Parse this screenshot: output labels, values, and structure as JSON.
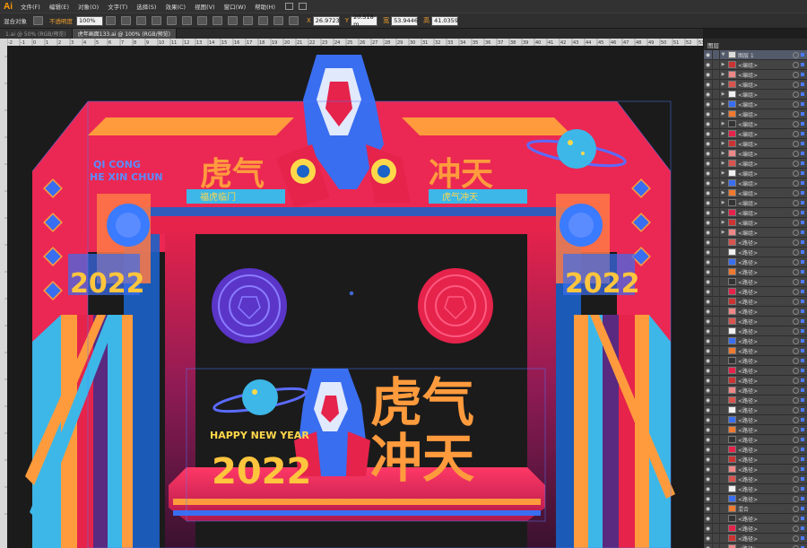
{
  "app": {
    "logo": "Ai"
  },
  "menu": [
    "文件(F)",
    "编辑(E)",
    "对象(O)",
    "文字(T)",
    "选择(S)",
    "效果(C)",
    "视图(V)",
    "窗口(W)",
    "帮助(H)"
  ],
  "control": {
    "selection": "混合对象",
    "opacity_link": "不透明度",
    "opacity_value": "100%",
    "x": "26.9723",
    "y": "20.518 m",
    "w": "53.9446",
    "h": "41.0359",
    "x_key": "X",
    "y_key": "Y",
    "w_key": "宽",
    "h_key": "高"
  },
  "tabs": [
    {
      "label": "1.ai @ 50% (RGB/预览)",
      "active": false
    },
    {
      "label": "虎年画面133.ai @ 100% (RGB/预览)",
      "active": true
    }
  ],
  "ruler_marks": [
    "-2",
    "-1",
    "0",
    "1",
    "2",
    "3",
    "4",
    "5",
    "6",
    "7",
    "8",
    "9",
    "10",
    "11",
    "12",
    "13",
    "14",
    "15",
    "16",
    "17",
    "18",
    "19",
    "20",
    "21",
    "22",
    "23",
    "24",
    "25",
    "26",
    "27",
    "28",
    "29",
    "30",
    "31",
    "32",
    "33",
    "34",
    "35",
    "36",
    "37",
    "38",
    "39",
    "40",
    "41",
    "42",
    "43",
    "44",
    "45",
    "46",
    "47",
    "48",
    "49",
    "50",
    "51",
    "52",
    "53",
    "54",
    "55"
  ],
  "artwork": {
    "title_left": "虎气",
    "title_right": "冲天",
    "pinyin_top": "QI CONG",
    "pinyin_bottom": "HE XIN CHUN",
    "banner_left": "福虎临门",
    "banner_right": "虎气冲天",
    "year": "2022",
    "happy": "HAPPY NEW YEAR",
    "big_title_1": "虎气",
    "big_title_2": "冲天"
  },
  "layers": {
    "panel_title": "图层",
    "top_layer": "图层 1",
    "items": [
      "<编组>",
      "<编组>",
      "<编组>",
      "<编组>",
      "<编组>",
      "<编组>",
      "<编组>",
      "<编组>",
      "<编组>",
      "<编组>",
      "<编组>",
      "<编组>",
      "<编组>",
      "<编组>",
      "<编组>",
      "<编组>",
      "<编组>",
      "<编组>",
      "<路径>",
      "<路径>",
      "<路径>",
      "<路径>",
      "<路径>",
      "<路径>",
      "<路径>",
      "<路径>",
      "<路径>",
      "<路径>",
      "<路径>",
      "<路径>",
      "<路径>",
      "<路径>",
      "<路径>",
      "<路径>",
      "<路径>",
      "<路径>",
      "<路径>",
      "<路径>",
      "<路径>",
      "<路径>",
      "<路径>",
      "<路径>",
      "<路径>",
      "<路径>",
      "<路径>",
      "混合",
      "<路径>",
      "<路径>",
      "<路径>",
      "<路径>",
      "<路径>"
    ]
  }
}
